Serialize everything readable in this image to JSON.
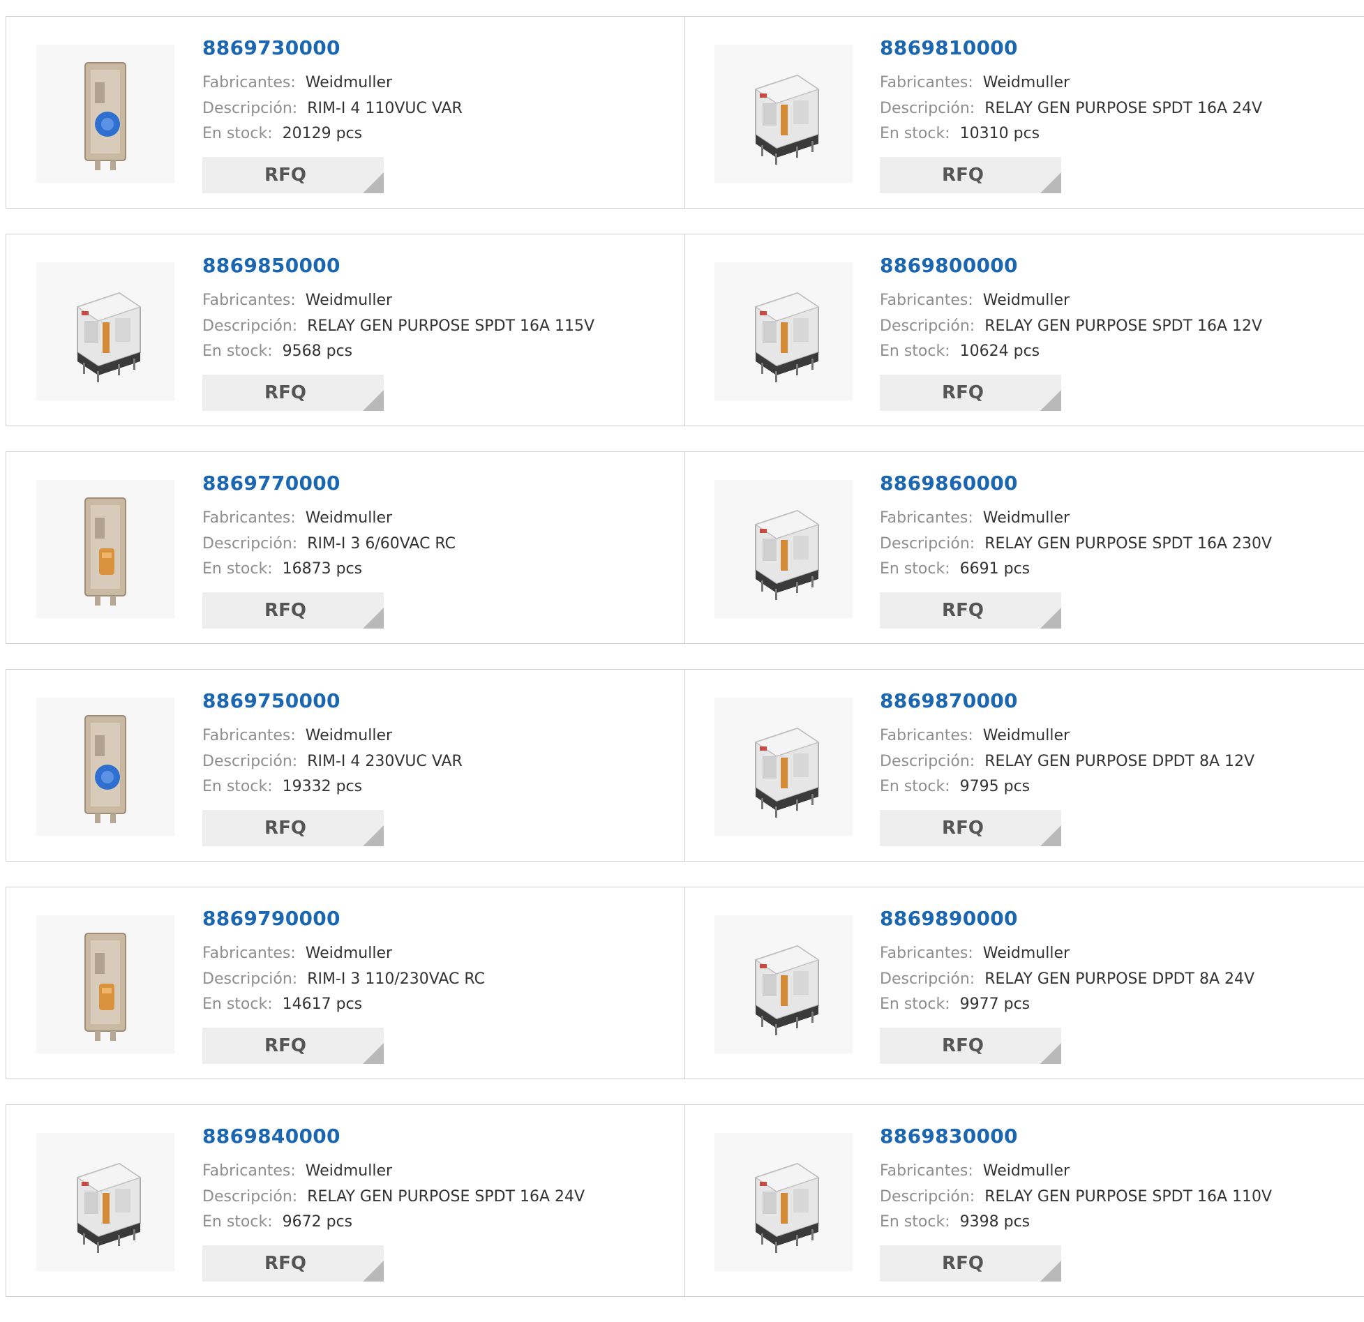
{
  "labels": {
    "manufacturer": "Fabricantes:",
    "description": "Descripción:",
    "stock": "En stock:",
    "rfq": "RFQ"
  },
  "colors": {
    "part_number": "#1b66b1",
    "label": "#8e8e8e",
    "rfq_bg": "#eeeeee"
  },
  "products": [
    {
      "part": "8869730000",
      "manufacturer": "Weidmuller",
      "description": "RIM-I 4 110VUC VAR",
      "stock": "20129 pcs",
      "image": "rim-module-blue-icon"
    },
    {
      "part": "8869810000",
      "manufacturer": "Weidmuller",
      "description": "RELAY GEN PURPOSE SPDT 16A 24V",
      "stock": "10310 pcs",
      "image": "relay-icon"
    },
    {
      "part": "8869850000",
      "manufacturer": "Weidmuller",
      "description": "RELAY GEN PURPOSE SPDT 16A 115V",
      "stock": "9568 pcs",
      "image": "relay-icon"
    },
    {
      "part": "8869800000",
      "manufacturer": "Weidmuller",
      "description": "RELAY GEN PURPOSE SPDT 16A 12V",
      "stock": "10624 pcs",
      "image": "relay-icon"
    },
    {
      "part": "8869770000",
      "manufacturer": "Weidmuller",
      "description": "RIM-I 3 6/60VAC RC",
      "stock": "16873 pcs",
      "image": "rim-module-orange-icon"
    },
    {
      "part": "8869860000",
      "manufacturer": "Weidmuller",
      "description": "RELAY GEN PURPOSE SPDT 16A 230V",
      "stock": "6691 pcs",
      "image": "relay-icon"
    },
    {
      "part": "8869750000",
      "manufacturer": "Weidmuller",
      "description": "RIM-I 4 230VUC VAR",
      "stock": "19332 pcs",
      "image": "rim-module-blue-icon"
    },
    {
      "part": "8869870000",
      "manufacturer": "Weidmuller",
      "description": "RELAY GEN PURPOSE DPDT 8A 12V",
      "stock": "9795 pcs",
      "image": "relay-icon"
    },
    {
      "part": "8869790000",
      "manufacturer": "Weidmuller",
      "description": "RIM-I 3 110/230VAC RC",
      "stock": "14617 pcs",
      "image": "rim-module-orange-icon"
    },
    {
      "part": "8869890000",
      "manufacturer": "Weidmuller",
      "description": "RELAY GEN PURPOSE DPDT 8A 24V",
      "stock": "9977 pcs",
      "image": "relay-icon"
    },
    {
      "part": "8869840000",
      "manufacturer": "Weidmuller",
      "description": "RELAY GEN PURPOSE SPDT 16A 24V",
      "stock": "9672 pcs",
      "image": "relay-icon"
    },
    {
      "part": "8869830000",
      "manufacturer": "Weidmuller",
      "description": "RELAY GEN PURPOSE SPDT 16A 110V",
      "stock": "9398 pcs",
      "image": "relay-icon"
    }
  ]
}
